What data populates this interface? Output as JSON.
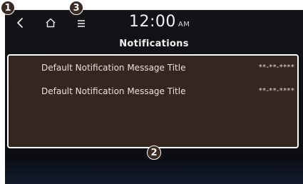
{
  "status_bar": {
    "time": "12:00",
    "ampm": "AM",
    "icons": [
      "back-icon",
      "home-icon",
      "menu-icon"
    ]
  },
  "page": {
    "title": "Notifications"
  },
  "notifications": [
    {
      "title": "Default Notification Message Title",
      "date": "**-**-****"
    },
    {
      "title": "Default Notification Message Title",
      "date": "**-**-****"
    }
  ],
  "callouts": [
    "1",
    "2",
    "3"
  ],
  "colors": {
    "panel_background": "#35261f",
    "panel_border": "#ffffff",
    "screen_background": "#141418",
    "callout_background": "#3a2a21"
  }
}
